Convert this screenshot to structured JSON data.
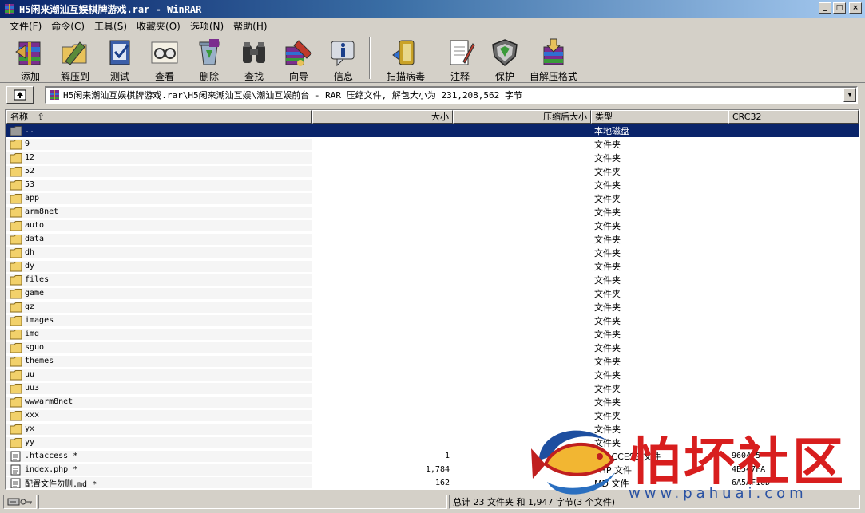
{
  "window": {
    "title": "H5闲来潮汕互娱棋牌游戏.rar - WinRAR"
  },
  "menu": [
    "文件(F)",
    "命令(C)",
    "工具(S)",
    "收藏夹(O)",
    "选项(N)",
    "帮助(H)"
  ],
  "toolbar": {
    "add": "添加",
    "extract": "解压到",
    "test": "测试",
    "view": "查看",
    "delete": "删除",
    "find": "查找",
    "wizard": "向导",
    "info": "信息",
    "virus": "扫描病毒",
    "comment": "注释",
    "protect": "保护",
    "sfx": "自解压格式"
  },
  "address": {
    "path": "H5闲来潮汕互娱棋牌游戏.rar\\H5闲来潮汕互娱\\潮汕互娱前台 - RAR 压缩文件, 解包大小为 231,208,562 字节"
  },
  "columns": {
    "name": "名称",
    "size": "大小",
    "packed": "压缩后大小",
    "type": "类型",
    "crc": "CRC32"
  },
  "files": [
    {
      "name": "..",
      "size": "",
      "packed": "",
      "type": "本地磁盘",
      "crc": ""
    },
    {
      "name": "9",
      "size": "",
      "packed": "",
      "type": "文件夹",
      "crc": ""
    },
    {
      "name": "12",
      "size": "",
      "packed": "",
      "type": "文件夹",
      "crc": ""
    },
    {
      "name": "52",
      "size": "",
      "packed": "",
      "type": "文件夹",
      "crc": ""
    },
    {
      "name": "53",
      "size": "",
      "packed": "",
      "type": "文件夹",
      "crc": ""
    },
    {
      "name": "app",
      "size": "",
      "packed": "",
      "type": "文件夹",
      "crc": ""
    },
    {
      "name": "arm8net",
      "size": "",
      "packed": "",
      "type": "文件夹",
      "crc": ""
    },
    {
      "name": "auto",
      "size": "",
      "packed": "",
      "type": "文件夹",
      "crc": ""
    },
    {
      "name": "data",
      "size": "",
      "packed": "",
      "type": "文件夹",
      "crc": ""
    },
    {
      "name": "dh",
      "size": "",
      "packed": "",
      "type": "文件夹",
      "crc": ""
    },
    {
      "name": "dy",
      "size": "",
      "packed": "",
      "type": "文件夹",
      "crc": ""
    },
    {
      "name": "files",
      "size": "",
      "packed": "",
      "type": "文件夹",
      "crc": ""
    },
    {
      "name": "game",
      "size": "",
      "packed": "",
      "type": "文件夹",
      "crc": ""
    },
    {
      "name": "gz",
      "size": "",
      "packed": "",
      "type": "文件夹",
      "crc": ""
    },
    {
      "name": "images",
      "size": "",
      "packed": "",
      "type": "文件夹",
      "crc": ""
    },
    {
      "name": "img",
      "size": "",
      "packed": "",
      "type": "文件夹",
      "crc": ""
    },
    {
      "name": "sguo",
      "size": "",
      "packed": "",
      "type": "文件夹",
      "crc": ""
    },
    {
      "name": "themes",
      "size": "",
      "packed": "",
      "type": "文件夹",
      "crc": ""
    },
    {
      "name": "uu",
      "size": "",
      "packed": "",
      "type": "文件夹",
      "crc": ""
    },
    {
      "name": "uu3",
      "size": "",
      "packed": "",
      "type": "文件夹",
      "crc": ""
    },
    {
      "name": "wwwarm8net",
      "size": "",
      "packed": "",
      "type": "文件夹",
      "crc": ""
    },
    {
      "name": "xxx",
      "size": "",
      "packed": "",
      "type": "文件夹",
      "crc": ""
    },
    {
      "name": "yx",
      "size": "",
      "packed": "",
      "type": "文件夹",
      "crc": ""
    },
    {
      "name": "yy",
      "size": "",
      "packed": "",
      "type": "文件夹",
      "crc": ""
    },
    {
      "name": ".htaccess *",
      "size": "1",
      "packed": "16",
      "type": "HTACCESS 文件",
      "crc": "9604_5"
    },
    {
      "name": "index.php *",
      "size": "1,784",
      "packed": "",
      "type": "PHP 文件",
      "crc": "4E547FA"
    },
    {
      "name": "配置文件勿删.md *",
      "size": "162",
      "packed": "",
      "type": "MD 文件",
      "crc": "6A5AF10D"
    }
  ],
  "status": {
    "total": "总计 23 文件夹 和 1,947 字节(3 个文件)"
  },
  "watermark": {
    "text": "怕坏社区",
    "url": "www.pahuai.com"
  }
}
